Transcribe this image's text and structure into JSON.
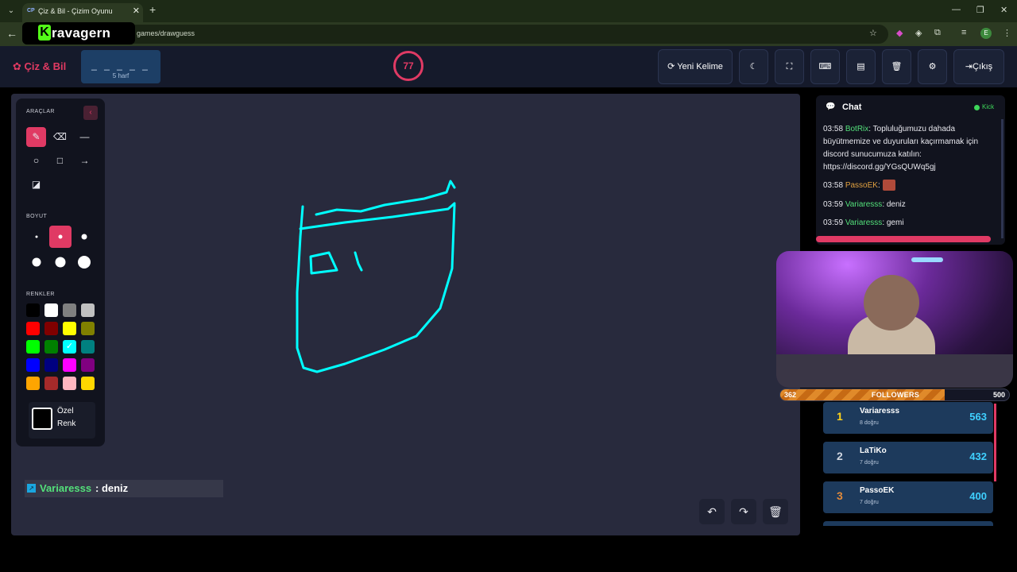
{
  "browser": {
    "tab_title": "Çiz & Bil - Çizim Oyunu",
    "tab_favicon": "CP",
    "url_partial": "games/drawguess",
    "logo_text": "ravagern",
    "logo_letter": "K",
    "profile_initial": "E"
  },
  "header": {
    "brand": "Çiz & Bil",
    "word_dashes": "_ _ _ _ _",
    "word_hint": "5 harf",
    "timer": "77",
    "new_word_label": "Yeni Kelime",
    "exit_label": "Çıkış"
  },
  "tools": {
    "tools_label": "ARAÇLAR",
    "size_label": "BOYUT",
    "colors_label": "RENKLER",
    "custom_color_line1": "Özel",
    "custom_color_line2": "Renk",
    "swatches": [
      "#000000",
      "#ffffff",
      "#808080",
      "#c0c0c0",
      "#ff0000",
      "#800000",
      "#ffff00",
      "#808000",
      "#00ff00",
      "#008000",
      "#00ffff",
      "#008080",
      "#0000ff",
      "#000080",
      "#ff00ff",
      "#800080",
      "#ffa500",
      "#a52a2a",
      "#ffb6c1",
      "#ffd700"
    ],
    "selected_color": "#00ffff"
  },
  "guess": {
    "user": "Variaresss",
    "text": ": deniz"
  },
  "chat": {
    "title": "Chat",
    "platform": "Kick",
    "messages": [
      {
        "time": "03:58",
        "user": "BotRix",
        "text": ": Topluluğumuzu dahada büyütmemize ve duyuruları kaçırmamak için discord sunucumuza katılın: https://discord.gg/YGsQUWq5gj",
        "color": "#53e07a"
      },
      {
        "time": "03:58",
        "user": "PassoEK",
        "text": ":",
        "color": "#e0a040"
      },
      {
        "time": "03:59",
        "user": "Variaresss",
        "text": ": deniz",
        "color": "#53e07a"
      },
      {
        "time": "03:59",
        "user": "Variaresss",
        "text": ": gemi",
        "color": "#53e07a"
      }
    ]
  },
  "followers": {
    "current": "362",
    "label": "FOLLOWERS",
    "goal": "500",
    "progress": 0.72
  },
  "leaderboard": [
    {
      "rank": "1",
      "name": "Variaresss",
      "sub": "8 doğru",
      "score": "563",
      "rank_color": "#ffd21a"
    },
    {
      "rank": "2",
      "name": "LaTiKo",
      "sub": "7 doğru",
      "score": "432",
      "rank_color": "#d0d6e0"
    },
    {
      "rank": "3",
      "name": "PassoEK",
      "sub": "7 doğru",
      "score": "400",
      "rank_color": "#e0893a"
    }
  ],
  "colors": {
    "accent": "#e03a64",
    "stroke": "#00ffff",
    "canvas_bg": "#282a3d"
  }
}
